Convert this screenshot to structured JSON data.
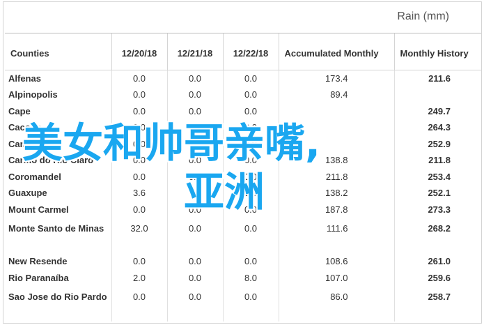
{
  "title": "Rain (mm)",
  "columns": [
    "Counties",
    "12/20/18",
    "12/21/18",
    "12/22/18",
    "Accumulated Monthly",
    "Monthly History"
  ],
  "rows": [
    {
      "county": "Alfenas",
      "d1": "0.0",
      "d2": "0.0",
      "d3": "0.0",
      "acc": "173.4",
      "hist": "211.6"
    },
    {
      "county": "Alpinopolis",
      "d1": "0.0",
      "d2": "0.0",
      "d3": "0.0",
      "acc": "89.4",
      "hist": ""
    },
    {
      "county": "Cape",
      "d1": "0.0",
      "d2": "0.0",
      "d3": "0.0",
      "acc": "",
      "hist": "249.7"
    },
    {
      "county": "Cacone",
      "d1": "0.0",
      "d2": "0.0",
      "d3": "0.0",
      "acc": "",
      "hist": "264.3"
    },
    {
      "county": "Campe",
      "d1": "0.0",
      "d2": "0.0",
      "d3": "0.0",
      "acc": "",
      "hist": "252.9"
    },
    {
      "county": "Carmo do Rio Claro",
      "d1": "0.0",
      "d2": "0.0",
      "d3": "0.0",
      "acc": "138.8",
      "hist": "211.8"
    },
    {
      "county": "Coromandel",
      "d1": "0.0",
      "d2": "0.0",
      "d3": "0.0",
      "acc": "211.8",
      "hist": "253.4"
    },
    {
      "county": "Guaxupe",
      "d1": "3.6",
      "d2": "0.0",
      "d3": "0.0",
      "acc": "138.2",
      "hist": "252.1"
    },
    {
      "county": "Mount Carmel",
      "d1": "0.0",
      "d2": "0.0",
      "d3": "0.0",
      "acc": "187.8",
      "hist": "273.3"
    },
    {
      "county": "Monte Santo de Minas",
      "d1": "32.0",
      "d2": "0.0",
      "d3": "0.0",
      "acc": "111.6",
      "hist": "268.2"
    },
    {
      "county": "New Resende",
      "d1": "0.0",
      "d2": "0.0",
      "d3": "0.0",
      "acc": "108.6",
      "hist": "261.0"
    },
    {
      "county": "Rio Paranaíba",
      "d1": "2.0",
      "d2": "0.0",
      "d3": "8.0",
      "acc": "107.0",
      "hist": "259.6"
    },
    {
      "county": "Sao Jose do Rio Pardo",
      "d1": "0.0",
      "d2": "0.0",
      "d3": "0.0",
      "acc": "86.0",
      "hist": "258.7"
    }
  ],
  "watermark": {
    "line1": "美女和帅哥亲嘴,",
    "line2": "亚洲",
    "color": "#1aa7f0"
  }
}
